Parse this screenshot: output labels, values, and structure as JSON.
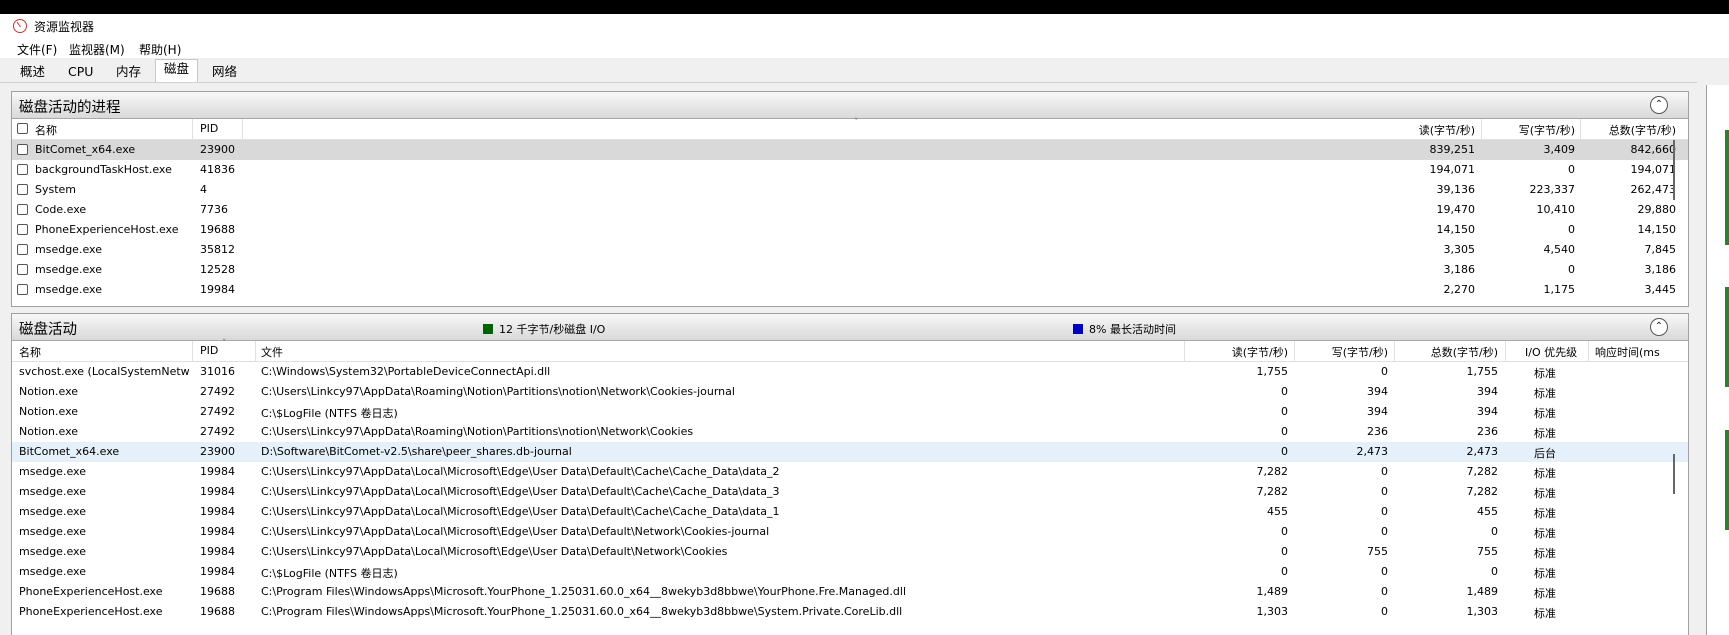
{
  "window": {
    "title": "资源监视器"
  },
  "menu": [
    "文件(F)",
    "监视器(M)",
    "帮助(H)"
  ],
  "tabs": [
    {
      "label": "概述",
      "active": false
    },
    {
      "label": "CPU",
      "active": false
    },
    {
      "label": "内存",
      "active": false
    },
    {
      "label": "磁盘",
      "active": true
    },
    {
      "label": "网络",
      "active": false
    }
  ],
  "processes": {
    "title": "磁盘活动的进程",
    "columns": {
      "name": "名称",
      "pid": "PID",
      "read": "读(字节/秒)",
      "write": "写(字节/秒)",
      "total": "总数(字节/秒)"
    },
    "rows": [
      {
        "name": "BitComet_x64.exe",
        "pid": "23900",
        "read": "839,251",
        "write": "3,409",
        "total": "842,660",
        "selected": true
      },
      {
        "name": "backgroundTaskHost.exe",
        "pid": "41836",
        "read": "194,071",
        "write": "0",
        "total": "194,071"
      },
      {
        "name": "System",
        "pid": "4",
        "read": "39,136",
        "write": "223,337",
        "total": "262,473"
      },
      {
        "name": "Code.exe",
        "pid": "7736",
        "read": "19,470",
        "write": "10,410",
        "total": "29,880"
      },
      {
        "name": "PhoneExperienceHost.exe",
        "pid": "19688",
        "read": "14,150",
        "write": "0",
        "total": "14,150"
      },
      {
        "name": "msedge.exe",
        "pid": "35812",
        "read": "3,305",
        "write": "4,540",
        "total": "7,845"
      },
      {
        "name": "msedge.exe",
        "pid": "12528",
        "read": "3,186",
        "write": "0",
        "total": "3,186"
      },
      {
        "name": "msedge.exe",
        "pid": "19984",
        "read": "2,270",
        "write": "1,175",
        "total": "3,445"
      }
    ]
  },
  "activity": {
    "title": "磁盘活动",
    "legend": [
      {
        "text": "12 千字节/秒磁盘 I/O",
        "color": "#006400"
      },
      {
        "text": "8% 最长活动时间",
        "color": "#0000c0"
      }
    ],
    "columns": {
      "name": "名称",
      "pid": "PID",
      "file": "文件",
      "read": "读(字节/秒)",
      "write": "写(字节/秒)",
      "total": "总数(字节/秒)",
      "priority": "I/O 优先级",
      "response": "响应时间(ms"
    },
    "rows": [
      {
        "name": "svchost.exe (LocalSystemNetw...",
        "pid": "31016",
        "file": "C:\\Windows\\System32\\PortableDeviceConnectApi.dll",
        "read": "1,755",
        "write": "0",
        "total": "1,755",
        "priority": "标准"
      },
      {
        "name": "Notion.exe",
        "pid": "27492",
        "file": "C:\\Users\\Linkcy97\\AppData\\Roaming\\Notion\\Partitions\\notion\\Network\\Cookies-journal",
        "read": "0",
        "write": "394",
        "total": "394",
        "priority": "标准"
      },
      {
        "name": "Notion.exe",
        "pid": "27492",
        "file": "C:\\$LogFile (NTFS 卷日志)",
        "read": "0",
        "write": "394",
        "total": "394",
        "priority": "标准"
      },
      {
        "name": "Notion.exe",
        "pid": "27492",
        "file": "C:\\Users\\Linkcy97\\AppData\\Roaming\\Notion\\Partitions\\notion\\Network\\Cookies",
        "read": "0",
        "write": "236",
        "total": "236",
        "priority": "标准"
      },
      {
        "name": "BitComet_x64.exe",
        "pid": "23900",
        "file": "D:\\Software\\BitComet-v2.5\\share\\peer_shares.db-journal",
        "read": "0",
        "write": "2,473",
        "total": "2,473",
        "priority": "后台",
        "highlight": true
      },
      {
        "name": "msedge.exe",
        "pid": "19984",
        "file": "C:\\Users\\Linkcy97\\AppData\\Local\\Microsoft\\Edge\\User Data\\Default\\Cache\\Cache_Data\\data_2",
        "read": "7,282",
        "write": "0",
        "total": "7,282",
        "priority": "标准"
      },
      {
        "name": "msedge.exe",
        "pid": "19984",
        "file": "C:\\Users\\Linkcy97\\AppData\\Local\\Microsoft\\Edge\\User Data\\Default\\Cache\\Cache_Data\\data_3",
        "read": "7,282",
        "write": "0",
        "total": "7,282",
        "priority": "标准"
      },
      {
        "name": "msedge.exe",
        "pid": "19984",
        "file": "C:\\Users\\Linkcy97\\AppData\\Local\\Microsoft\\Edge\\User Data\\Default\\Cache\\Cache_Data\\data_1",
        "read": "455",
        "write": "0",
        "total": "455",
        "priority": "标准"
      },
      {
        "name": "msedge.exe",
        "pid": "19984",
        "file": "C:\\Users\\Linkcy97\\AppData\\Local\\Microsoft\\Edge\\User Data\\Default\\Network\\Cookies-journal",
        "read": "0",
        "write": "0",
        "total": "0",
        "priority": "标准"
      },
      {
        "name": "msedge.exe",
        "pid": "19984",
        "file": "C:\\Users\\Linkcy97\\AppData\\Local\\Microsoft\\Edge\\User Data\\Default\\Network\\Cookies",
        "read": "0",
        "write": "755",
        "total": "755",
        "priority": "标准"
      },
      {
        "name": "msedge.exe",
        "pid": "19984",
        "file": "C:\\$LogFile (NTFS 卷日志)",
        "read": "0",
        "write": "0",
        "total": "0",
        "priority": "标准"
      },
      {
        "name": "PhoneExperienceHost.exe",
        "pid": "19688",
        "file": "C:\\Program Files\\WindowsApps\\Microsoft.YourPhone_1.25031.60.0_x64__8wekyb3d8bbwe\\YourPhone.Fre.Managed.dll",
        "read": "1,489",
        "write": "0",
        "total": "1,489",
        "priority": "标准"
      },
      {
        "name": "PhoneExperienceHost.exe",
        "pid": "19688",
        "file": "C:\\Program Files\\WindowsApps\\Microsoft.YourPhone_1.25031.60.0_x64__8wekyb3d8bbwe\\System.Private.CoreLib.dll",
        "read": "1,303",
        "write": "0",
        "total": "1,303",
        "priority": "标准"
      }
    ]
  }
}
